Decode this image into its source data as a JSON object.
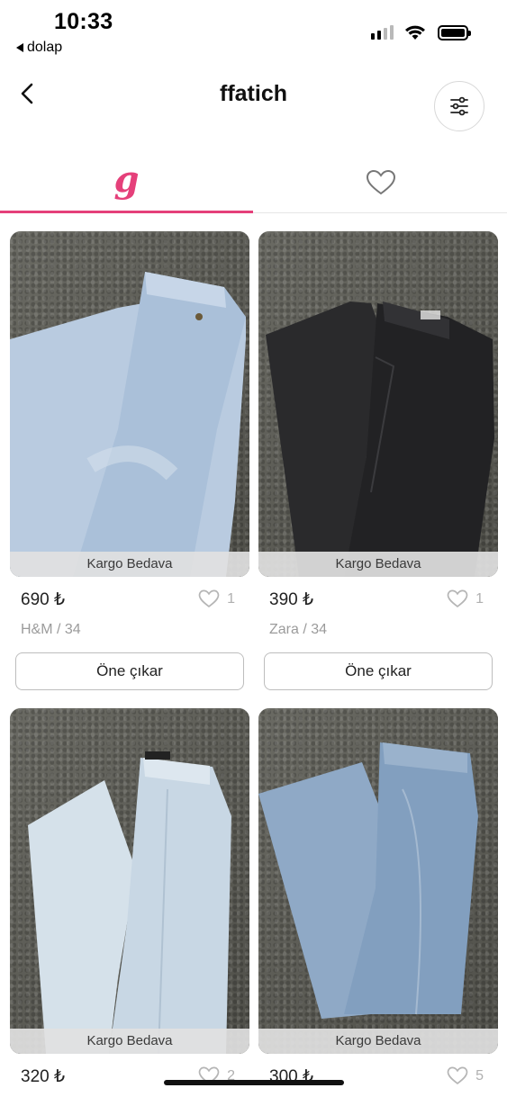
{
  "status_bar": {
    "time": "10:33",
    "back_app": "dolap"
  },
  "header": {
    "title": "ffatich"
  },
  "tabs": [
    {
      "icon": "dolap-g-logo",
      "glyph": "g",
      "active": true
    },
    {
      "icon": "heart-icon",
      "active": false
    }
  ],
  "accent_color": "#e5407a",
  "products": [
    {
      "ribbon": "Kargo Bedava",
      "price": "690 ₺",
      "likes": "1",
      "meta": "H&M / 34",
      "button": "Öne çıkar",
      "denim": "light"
    },
    {
      "ribbon": "Kargo Bedava",
      "price": "390 ₺",
      "likes": "1",
      "meta": "Zara / 34",
      "button": "Öne çıkar",
      "denim": "black"
    },
    {
      "ribbon": "Kargo Bedava",
      "price": "320 ₺",
      "likes": "2",
      "denim": "pale"
    },
    {
      "ribbon": "Kargo Bedava",
      "price": "300 ₺",
      "likes": "5",
      "denim": "mid"
    }
  ]
}
